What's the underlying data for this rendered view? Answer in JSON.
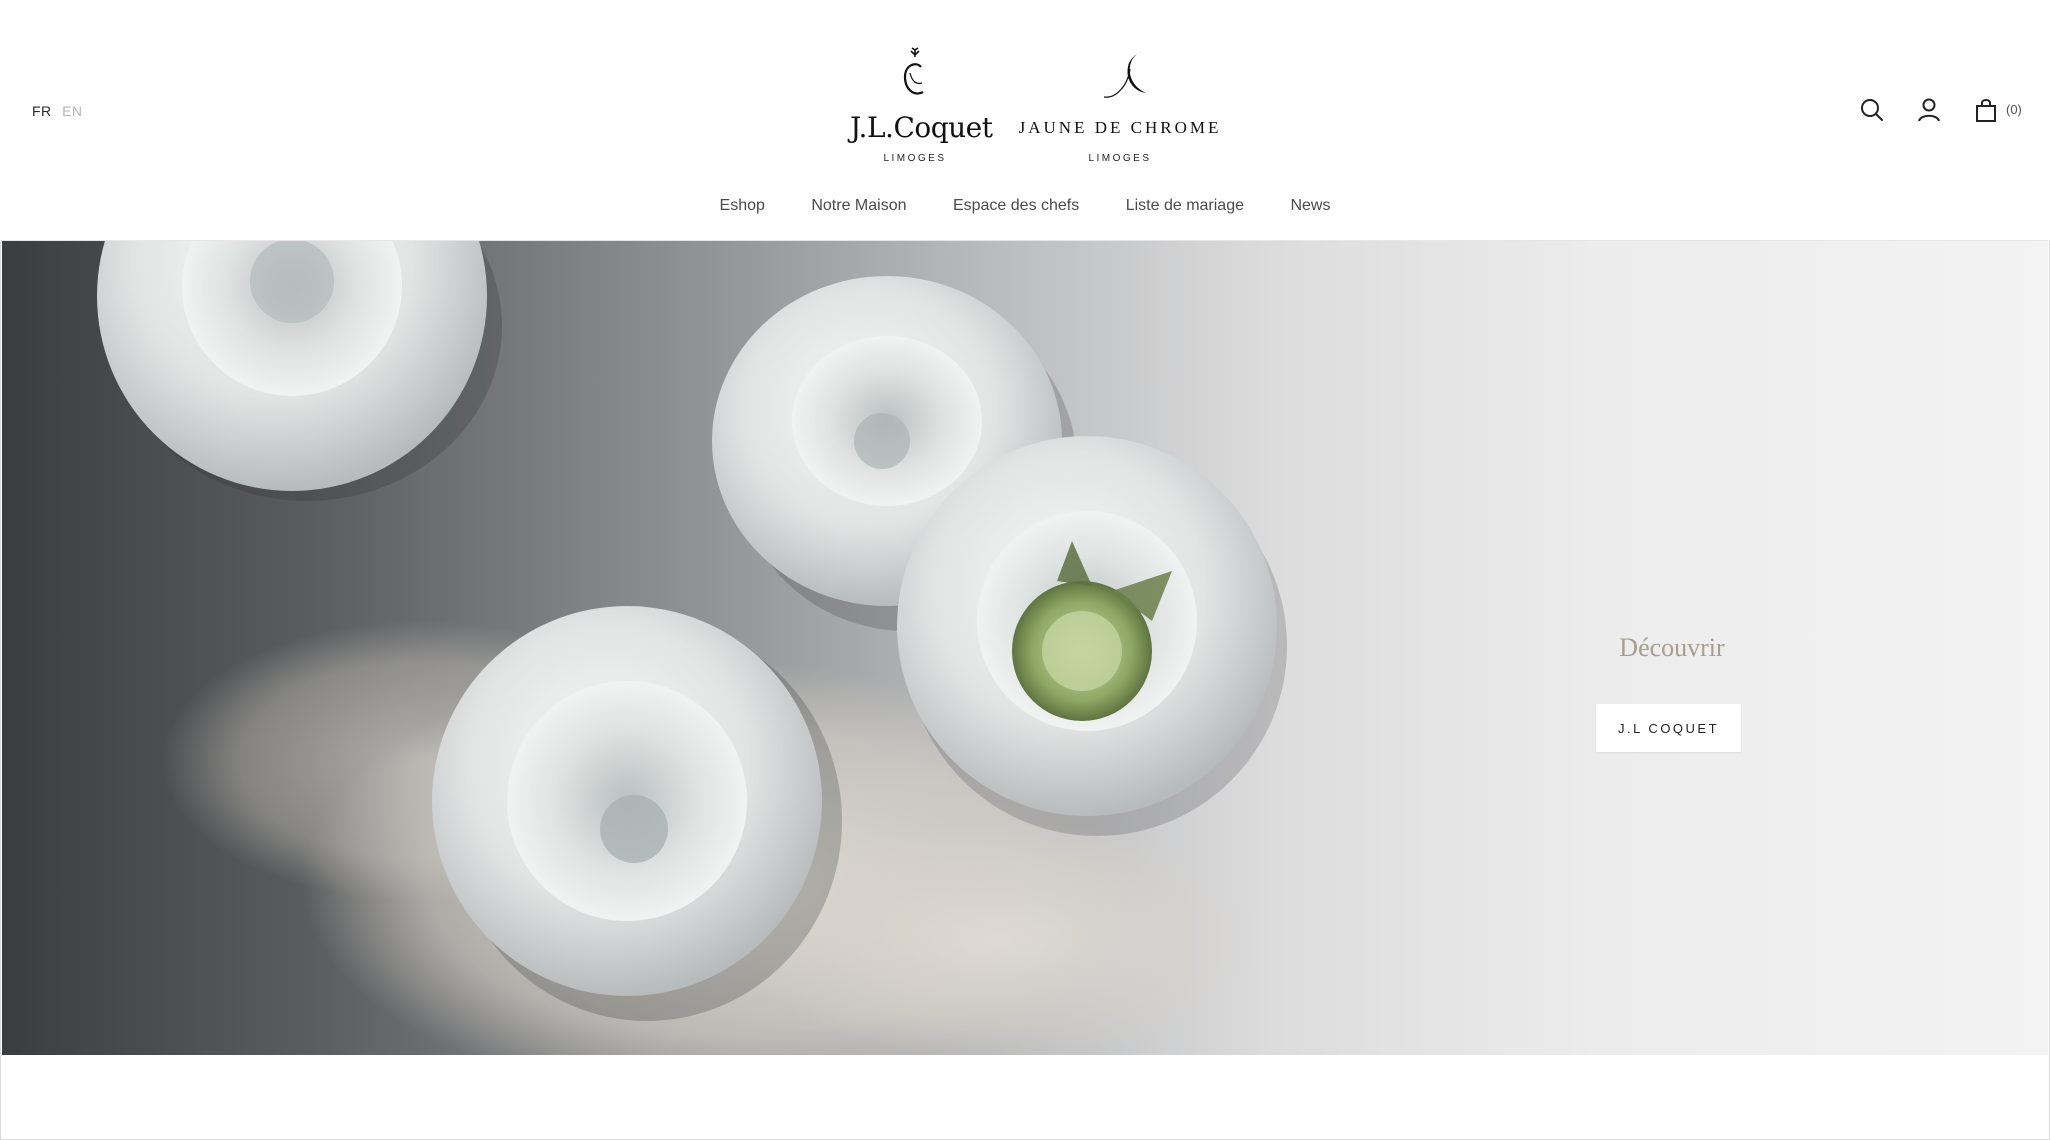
{
  "header": {
    "languages": [
      {
        "code": "FR",
        "active": true
      },
      {
        "code": "EN",
        "active": false
      }
    ],
    "brand_left": {
      "name": "J.L.Coquet",
      "city": "LIMOGES"
    },
    "brand_right": {
      "name": "JAUNE DE CHROME",
      "city": "LIMOGES"
    },
    "nav": [
      "Eshop",
      "Notre Maison",
      "Espace des chefs",
      "Liste de mariage",
      "News"
    ],
    "icons": {
      "search": "search-icon",
      "account": "user-icon",
      "cart": "bag-icon"
    },
    "cart_count": "(0)"
  },
  "hero": {
    "title": "Découvrir",
    "button_label": "J.L COQUET"
  },
  "colors": {
    "accent_text": "#a99e8d",
    "nav_text": "#4a4a4a"
  }
}
